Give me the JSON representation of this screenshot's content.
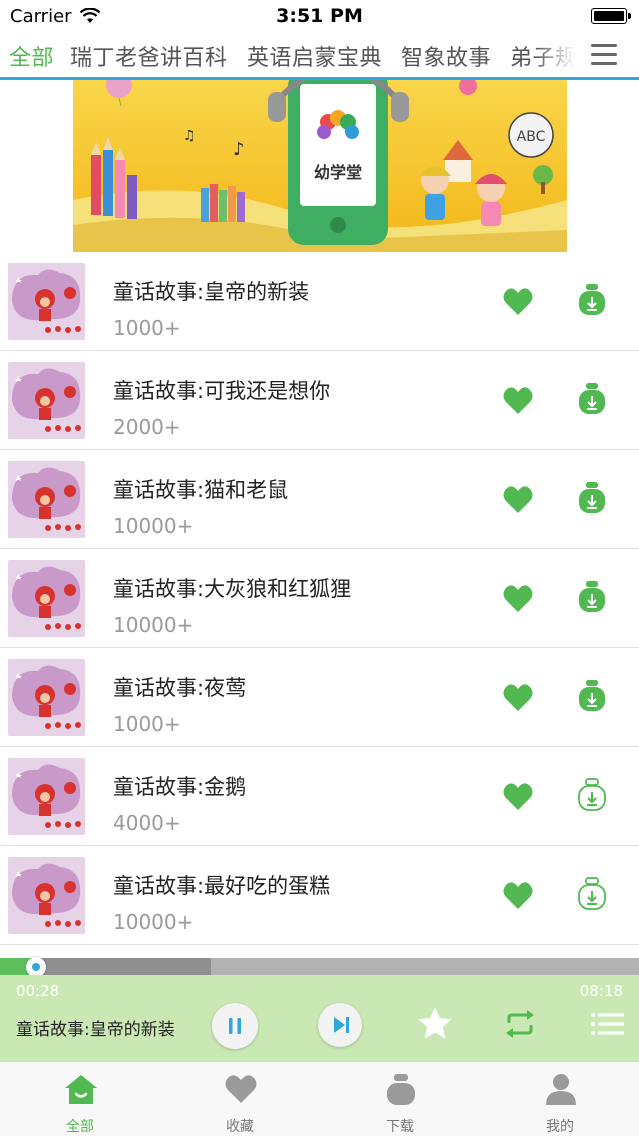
{
  "status_bar": {
    "carrier": "Carrier",
    "time": "3:51 PM"
  },
  "tabs": [
    {
      "label": "全部",
      "active": true
    },
    {
      "label": "瑞丁老爸讲百科",
      "active": false
    },
    {
      "label": "英语启蒙宝典",
      "active": false
    },
    {
      "label": "智象故事",
      "active": false
    },
    {
      "label": "弟子规",
      "active": false
    }
  ],
  "banner": {
    "logo_text": "幼学堂",
    "sign_text": "ABC"
  },
  "list": {
    "items": [
      {
        "title": "童话故事:皇帝的新装",
        "count": "1000+",
        "downloaded": true
      },
      {
        "title": "童话故事:可我还是想你",
        "count": "2000+",
        "downloaded": true
      },
      {
        "title": "童话故事:猫和老鼠",
        "count": "10000+",
        "downloaded": true
      },
      {
        "title": "童话故事:大灰狼和红狐狸",
        "count": "10000+",
        "downloaded": true
      },
      {
        "title": "童话故事:夜莺",
        "count": "1000+",
        "downloaded": true
      },
      {
        "title": "童话故事:金鹅",
        "count": "4000+",
        "downloaded": false
      },
      {
        "title": "童话故事:最好吃的蛋糕",
        "count": "10000+",
        "downloaded": false
      }
    ]
  },
  "player": {
    "current_time": "00:28",
    "total_time": "08:18",
    "progress_fraction": 0.056,
    "buffered_fraction": 0.33,
    "now_playing": "童话故事:皇帝的新装"
  },
  "tabbar": {
    "items": [
      {
        "label": "全部",
        "icon": "home-icon",
        "active": true
      },
      {
        "label": "收藏",
        "icon": "heart-icon",
        "active": false
      },
      {
        "label": "下载",
        "icon": "download-bag-icon",
        "active": false
      },
      {
        "label": "我的",
        "icon": "user-icon",
        "active": false
      }
    ]
  },
  "colors": {
    "accent_green": "#52b852",
    "tab_underline": "#2fa7d9",
    "player_bg": "#c9e8b4"
  }
}
